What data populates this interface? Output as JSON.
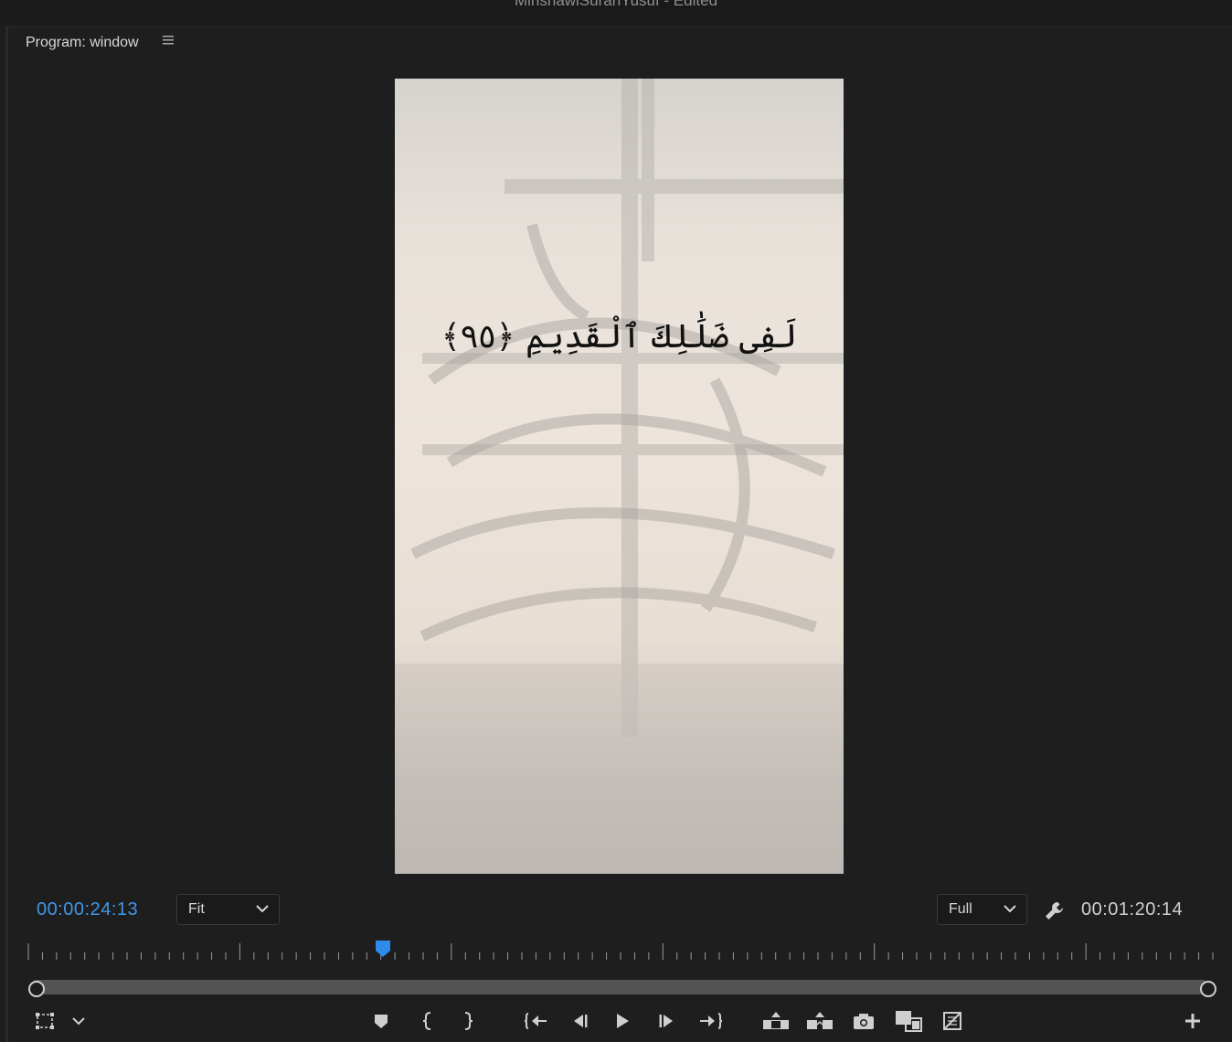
{
  "app": {
    "title": "MinshawiSurahYusuf - Edited"
  },
  "panel": {
    "title": "Program: window",
    "menu_icon": "hamburger-menu-icon"
  },
  "video": {
    "verse_text": "لَفِى ضَلَٰلِكَ ٱلْقَدِيمِ ﴿٩٥﴾"
  },
  "timecode": {
    "current": "00:00:24:13",
    "duration": "00:01:20:14",
    "current_color": "#3f97e8"
  },
  "zoom": {
    "selected": "Fit"
  },
  "resolution": {
    "selected": "Full"
  },
  "playhead_position": 0.3,
  "icons": {
    "settings": "wrench-icon",
    "left_controls": [
      "safe-margins-icon",
      "chevron-down-icon"
    ],
    "transport": [
      "add-marker-icon",
      "mark-in-icon",
      "mark-out-icon",
      "go-to-in-icon",
      "step-back-icon",
      "play-icon",
      "step-forward-icon",
      "go-to-out-icon"
    ],
    "edit": [
      "lift-icon",
      "extract-icon",
      "export-frame-icon",
      "comparison-view-icon",
      "proxy-toggle-icon"
    ],
    "right": "button-editor-plus-icon"
  }
}
